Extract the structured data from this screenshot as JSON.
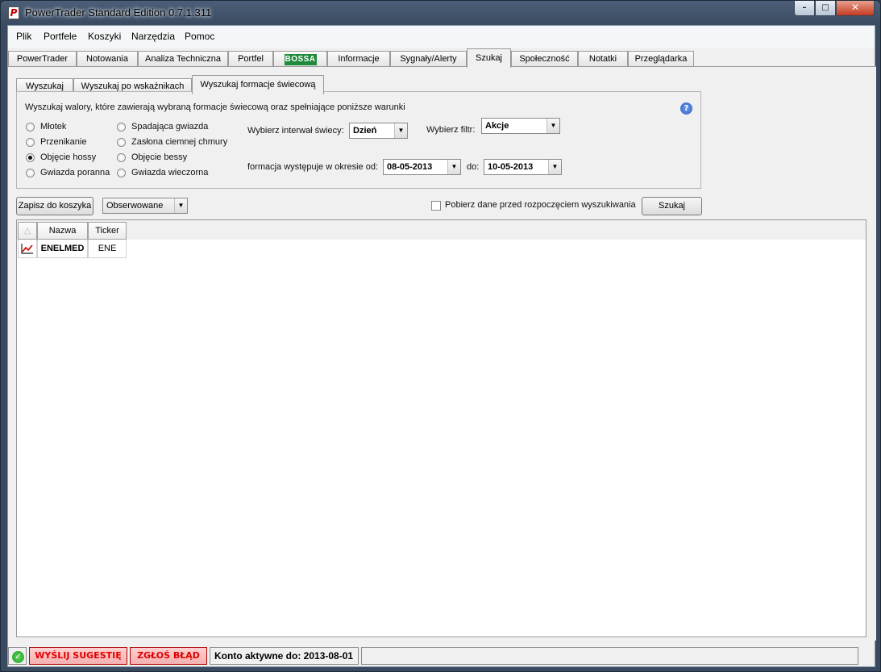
{
  "window": {
    "title": "PowerTrader Standard Edition 0.7.1.311",
    "minimize": "–",
    "maximize": "□",
    "close": "✕"
  },
  "menu": [
    "Plik",
    "Portfele",
    "Koszyki",
    "Narzędzia",
    "Pomoc"
  ],
  "main_tabs": [
    {
      "label": "PowerTrader"
    },
    {
      "label": "Notowania"
    },
    {
      "label": "Analiza Techniczna"
    },
    {
      "label": "Portfel"
    },
    {
      "label": "BOSSA"
    },
    {
      "label": "Informacje"
    },
    {
      "label": "Sygnały/Alerty"
    },
    {
      "label": "Szukaj",
      "active": true
    },
    {
      "label": "Społeczność"
    },
    {
      "label": "Notatki"
    },
    {
      "label": "Przeglądarka"
    }
  ],
  "sub_tabs": [
    {
      "label": "Wyszukaj"
    },
    {
      "label": "Wyszukaj po wskaźnikach"
    },
    {
      "label": "Wyszukaj formacje świecową",
      "active": true
    }
  ],
  "search_panel": {
    "description": "Wyszukaj walory, które zawierają wybraną formacje świecową oraz spełniające poniższe warunki",
    "help": "?",
    "patterns_col1": [
      {
        "label": "Młotek",
        "checked": false
      },
      {
        "label": "Przenikanie",
        "checked": false
      },
      {
        "label": "Objęcie hossy",
        "checked": true
      },
      {
        "label": "Gwiazda poranna",
        "checked": false
      }
    ],
    "patterns_col2": [
      {
        "label": "Spadająca gwiazda",
        "checked": false
      },
      {
        "label": "Zasłona ciemnej chmury",
        "checked": false
      },
      {
        "label": "Objęcie bessy",
        "checked": false
      },
      {
        "label": "Gwiazda wieczorna",
        "checked": false
      }
    ],
    "interval_label": "Wybierz interwał świecy:",
    "interval_value": "Dzień",
    "filter_label": "Wybierz filtr:",
    "filter_value": "Akcje",
    "period_label": "formacja występuje w okresie od:",
    "date_from": "08-05-2013",
    "to_label": "do:",
    "date_to": "10-05-2013"
  },
  "toolbar": {
    "save_basket": "Zapisz do koszyka",
    "basket_select": "Obserwowane",
    "fetch_checkbox_label": "Pobierz dane przed rozpoczęciem wyszukiwania",
    "search_button": "Szukaj"
  },
  "table": {
    "columns": [
      "Nazwa",
      "Ticker"
    ],
    "rows": [
      {
        "name": "ENELMED",
        "ticker": "ENE"
      }
    ]
  },
  "statusbar": {
    "suggest": "WYŚLIJ SUGESTIĘ",
    "report_bug": "ZGŁOŚ BŁĄD",
    "account_status": "Konto aktywne do: 2013-08-01"
  }
}
